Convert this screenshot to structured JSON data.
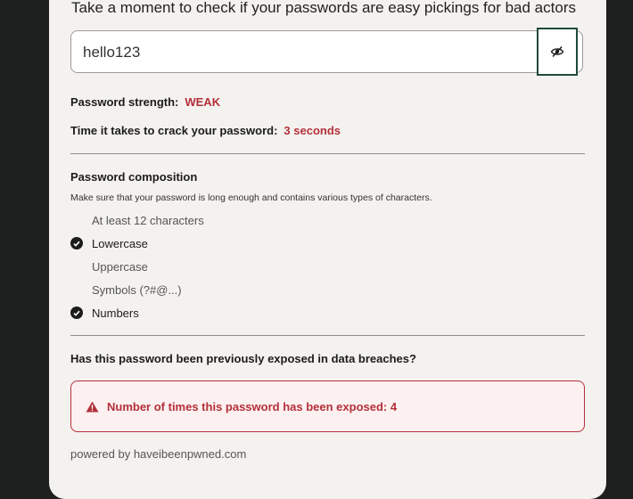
{
  "header": {
    "title": "Take a moment to check if your passwords are easy pickings for bad actors"
  },
  "password": {
    "value": "hello123",
    "toggle_icon": "eye-slash-icon"
  },
  "strength": {
    "label": "Password strength:",
    "value": "WEAK"
  },
  "crack_time": {
    "label": "Time it takes to crack your password:",
    "value": "3 seconds"
  },
  "composition": {
    "title": "Password composition",
    "hint": "Make sure that your password is long enough and contains various types of characters.",
    "items": [
      {
        "label": "At least 12 characters",
        "met": false
      },
      {
        "label": "Lowercase",
        "met": true
      },
      {
        "label": "Uppercase",
        "met": false
      },
      {
        "label": "Symbols (?#@...)",
        "met": false
      },
      {
        "label": "Numbers",
        "met": true
      }
    ]
  },
  "breach": {
    "title": "Has this password been previously exposed in data breaches?",
    "message": "Number of times this password has been exposed: 4",
    "icon": "warning-icon"
  },
  "footer": {
    "powered_by": "powered by haveibeenpwned.com"
  },
  "colors": {
    "accent_red": "#b3303a",
    "card_bg": "#f4f2ef",
    "button_border": "#1f4a3a"
  }
}
